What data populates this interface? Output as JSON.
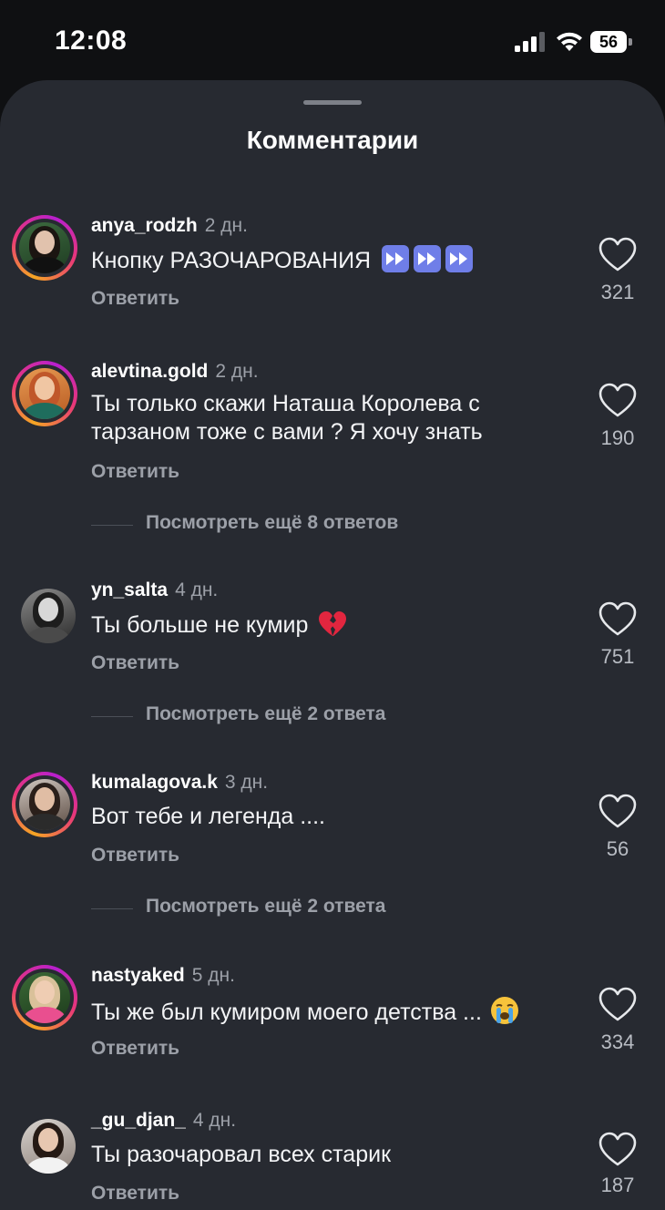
{
  "status_bar": {
    "time": "12:08",
    "battery": "56"
  },
  "sheet": {
    "title": "Комментарии"
  },
  "reply_label": "Ответить",
  "comments": [
    {
      "username": "anya_rodzh",
      "age": "2 дн.",
      "text": "Кнопку РАЗОЧАРОВАНИЯ",
      "emojis": [
        "fast-forward-icon",
        "fast-forward-icon",
        "fast-forward-icon"
      ],
      "likes": "321",
      "has_story_ring": true,
      "more_replies": null
    },
    {
      "username": "alevtina.gold",
      "age": "2 дн.",
      "text_lines": [
        "Ты только скажи Наташа Королева с",
        "тарзаном тоже с вами ? Я хочу знать"
      ],
      "likes": "190",
      "has_story_ring": true,
      "more_replies": "Посмотреть ещё 8 ответов"
    },
    {
      "username": "yn_salta",
      "age": "4 дн.",
      "text": "Ты больше не кумир",
      "emojis": [
        "broken-heart-icon"
      ],
      "likes": "751",
      "has_story_ring": false,
      "more_replies": "Посмотреть ещё 2 ответа"
    },
    {
      "username": "kumalagova.k",
      "age": "3 дн.",
      "text": "Вот тебе и легенда ....",
      "likes": "56",
      "has_story_ring": true,
      "more_replies": "Посмотреть ещё 2 ответа"
    },
    {
      "username": "nastyaked",
      "age": "5 дн.",
      "text": "Ты же был кумиром моего детства ...",
      "emojis": [
        "crying-face-icon"
      ],
      "likes": "334",
      "has_story_ring": true,
      "more_replies": null
    },
    {
      "username": "_gu_djan_",
      "age": "4 дн.",
      "text": "Ты разочаровал всех старик",
      "likes": "187",
      "has_story_ring": false,
      "more_replies": null
    }
  ],
  "colors": {
    "sheet_background": "#272a31",
    "ring_gradient": [
      "#f5a623",
      "#e8367a",
      "#b81fce"
    ],
    "secondary_text": "#9ca0a8"
  }
}
